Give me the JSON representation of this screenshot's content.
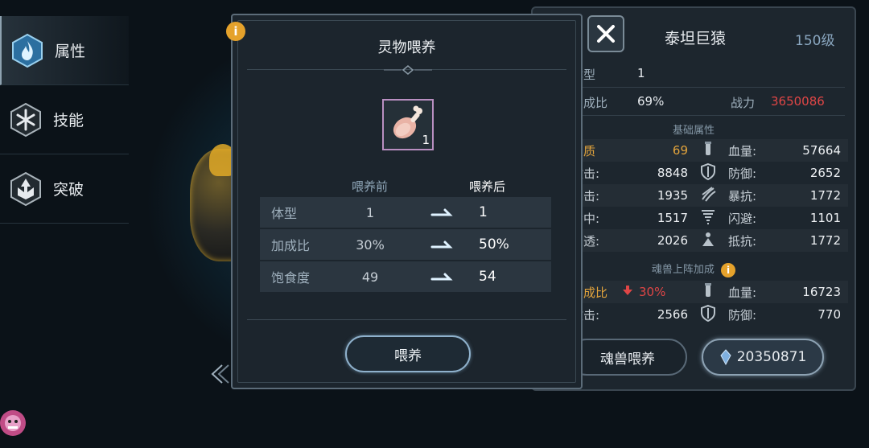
{
  "nav": [
    {
      "label": "属性",
      "icon": "flame-icon"
    },
    {
      "label": "技能",
      "icon": "snowflake-icon"
    },
    {
      "label": "突破",
      "icon": "breakthrough-icon"
    }
  ],
  "pet": {
    "name": "泰坦巨猿",
    "level": "150级",
    "body_type_label": "体型",
    "body_type_value": "1",
    "bonus_label": "加成比",
    "bonus_value": "69%",
    "power_label": "战力",
    "power_value": "3650086"
  },
  "base_stats": {
    "title": "基础属性",
    "rows": [
      {
        "l_label": "资质",
        "l_value": "69",
        "r_label": "血量:",
        "r_value": "57664"
      },
      {
        "l_label": "攻击:",
        "l_value": "8848",
        "r_label": "防御:",
        "r_value": "2652"
      },
      {
        "l_label": "暴击:",
        "l_value": "1935",
        "r_label": "暴抗:",
        "r_value": "1772"
      },
      {
        "l_label": "命中:",
        "l_value": "1517",
        "r_label": "闪避:",
        "r_value": "1101"
      },
      {
        "l_label": "穿透:",
        "l_value": "2026",
        "r_label": "抵抗:",
        "r_value": "1772"
      }
    ]
  },
  "deploy_bonus": {
    "title": "魂兽上阵加成",
    "rows": [
      {
        "l_label": "加成比",
        "l_value": "30%",
        "r_label": "血量:",
        "r_value": "16723"
      },
      {
        "l_label": "攻击:",
        "l_value": "2566",
        "r_label": "防御:",
        "r_value": "770"
      }
    ]
  },
  "right_buttons": {
    "feed_label": "魂兽喂养",
    "currency_value": "20350871"
  },
  "modal": {
    "title": "灵物喂养",
    "item_count": "1",
    "col_before": "喂养前",
    "col_after": "喂养后",
    "rows": [
      {
        "label": "体型",
        "before": "1",
        "after": "1"
      },
      {
        "label": "加成比",
        "before": "30%",
        "after": "50%"
      },
      {
        "label": "饱食度",
        "before": "49",
        "after": "54"
      }
    ],
    "feed_button": "喂养"
  },
  "colors": {
    "accent_orange": "#e5a22b",
    "power_red": "#e04646",
    "aptitude_gold": "#e3a43c",
    "level_blue": "#8aa7c0"
  }
}
